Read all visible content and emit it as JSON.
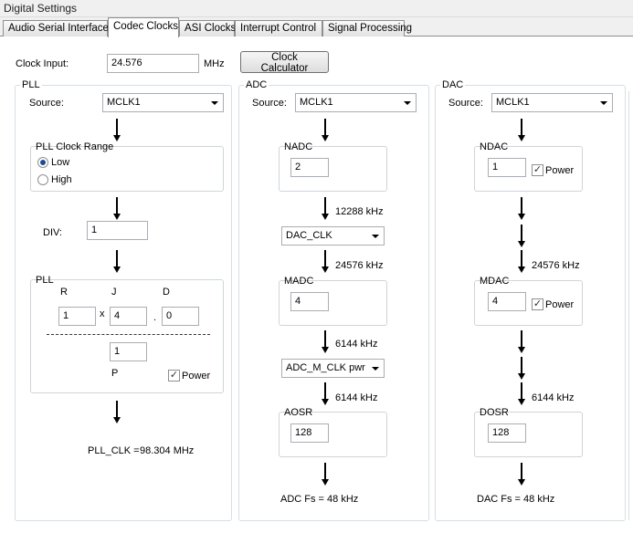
{
  "window": {
    "title": "Digital Settings"
  },
  "tabs": [
    "Audio Serial Interface",
    "Codec Clocks",
    "ASI Clocks",
    "Interrupt Control",
    "Signal Processing"
  ],
  "clock_input": {
    "label": "Clock Input:",
    "value": "24.576",
    "unit": "MHz",
    "calculator_label": "Clock Calculator"
  },
  "pll": {
    "title": "PLL",
    "source_label": "Source:",
    "source_value": "MCLK1",
    "range_title": "PLL Clock Range",
    "range_low": "Low",
    "range_high": "High",
    "range_selected": "Low",
    "div_label": "DIV:",
    "div_value": "1",
    "inner_title": "PLL",
    "r_label": "R",
    "j_label": "J",
    "d_label": "D",
    "r_value": "1",
    "times": "x",
    "j_value": "4",
    "dot": ".",
    "d_value": "0",
    "p_value": "1",
    "p_label": "P",
    "power_label": "Power",
    "power_checked": true,
    "pll_clk_label": "PLL_CLK =",
    "pll_clk_value": "98.304 MHz"
  },
  "adc": {
    "title": "ADC",
    "source_label": "Source:",
    "source_value": "MCLK1",
    "nadc_label": "NADC",
    "nadc_value": "2",
    "freq1": "12288 kHz",
    "clk_select": "DAC_CLK",
    "freq2": "24576 kHz",
    "madc_label": "MADC",
    "madc_value": "4",
    "freq3": "6144 kHz",
    "m_clk_select": "ADC_M_CLK pwr",
    "freq4": "6144 kHz",
    "aosr_label": "AOSR",
    "aosr_value": "128",
    "fs": "ADC Fs = 48 kHz"
  },
  "dac": {
    "title": "DAC",
    "source_label": "Source:",
    "source_value": "MCLK1",
    "ndac_label": "NDAC",
    "ndac_value": "1",
    "ndac_power": "Power",
    "ndac_checked": true,
    "freq1": "24576 kHz",
    "mdac_label": "MDAC",
    "mdac_value": "4",
    "mdac_power": "Power",
    "mdac_checked": true,
    "freq2": "6144 kHz",
    "dosr_label": "DOSR",
    "dosr_value": "128",
    "fs": "DAC Fs = 48 kHz"
  },
  "icons": {
    "flow_arrow": "down-arrow-icon",
    "dropdown": "chevron-down-icon",
    "checkmark": "check-icon"
  }
}
